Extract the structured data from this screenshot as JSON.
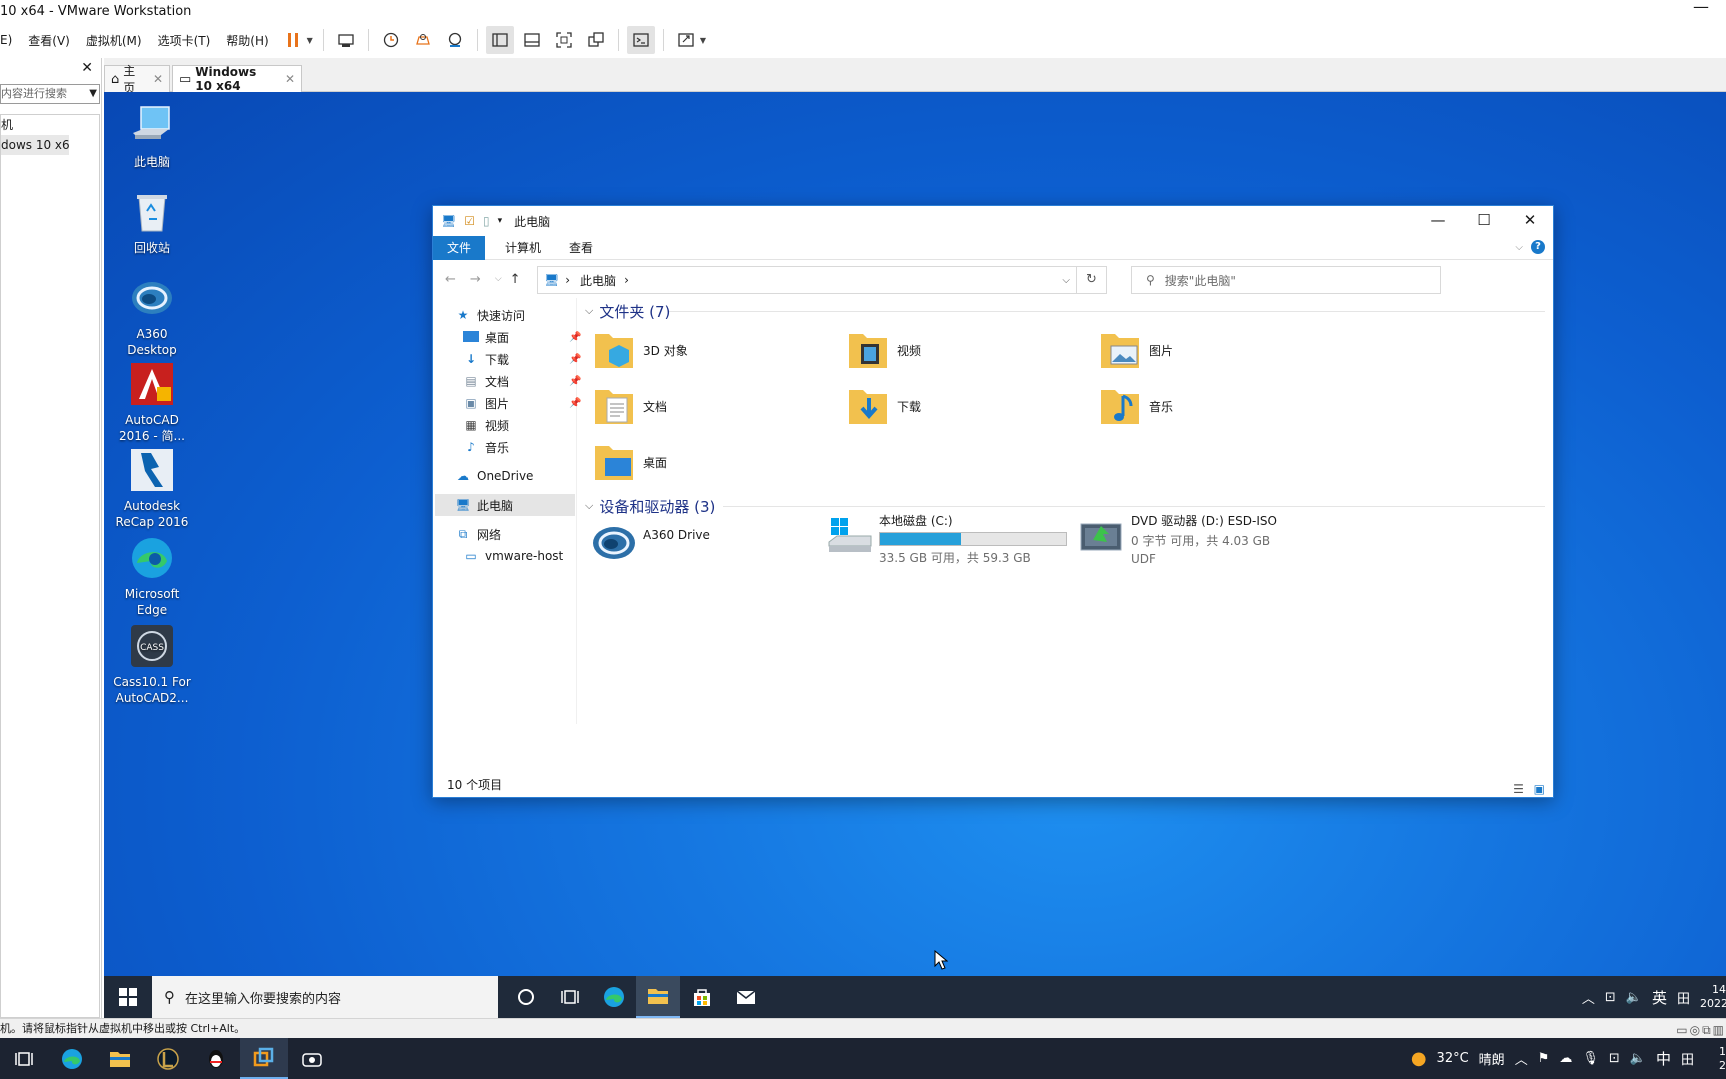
{
  "host_window": {
    "title": "10 x64 - VMware Workstation",
    "minimize": "—",
    "menus": [
      "E)",
      "查看(V)",
      "虚拟机(M)",
      "选项卡(T)",
      "帮助(H)"
    ]
  },
  "library": {
    "close": "✕",
    "search_text": "内容进行搜索",
    "tree": [
      "机",
      "dows 10 x64"
    ]
  },
  "vm_tabs": [
    {
      "label": "主页",
      "close": "✕"
    },
    {
      "label": "Windows 10 x64",
      "close": "✕"
    }
  ],
  "desktop_icons": [
    {
      "label": "此电脑",
      "icon": "computer-icon"
    },
    {
      "label": "回收站",
      "icon": "recycle-bin-icon"
    },
    {
      "label": "A360 Desktop",
      "icon": "a360-icon"
    },
    {
      "label": "AutoCAD 2016 - 简...",
      "icon": "autocad-icon"
    },
    {
      "label": "Autodesk ReCap 2016",
      "icon": "recap-icon"
    },
    {
      "label": "Microsoft Edge",
      "icon": "edge-icon"
    },
    {
      "label": "Cass10.1 For AutoCAD2...",
      "icon": "cass-icon"
    }
  ],
  "explorer": {
    "title": "此电脑",
    "window_controls": {
      "minimize": "—",
      "maximize": "☐",
      "close": "✕"
    },
    "ribbon_tabs": [
      "文件",
      "计算机",
      "查看"
    ],
    "help": "?",
    "address": {
      "path": "此电脑",
      "search_placeholder": "搜索\"此电脑\""
    },
    "nav": {
      "quick_access": "快速访问",
      "quick_items": [
        "桌面",
        "下载",
        "文档",
        "图片",
        "视频",
        "音乐"
      ],
      "onedrive": "OneDrive",
      "this_pc": "此电脑",
      "network": "网络",
      "network_items": [
        "vmware-host"
      ]
    },
    "folders_header": "文件夹 (7)",
    "folders": [
      "3D 对象",
      "视频",
      "图片",
      "文档",
      "下载",
      "音乐",
      "桌面"
    ],
    "devices_header": "设备和驱动器 (3)",
    "devices": [
      {
        "name": "A360 Drive"
      },
      {
        "name": "本地磁盘 (C:)",
        "detail": "33.5 GB 可用，共 59.3 GB",
        "used_fraction": 0.435
      },
      {
        "name": "DVD 驱动器 (D:) ESD-ISO",
        "detail": "0 字节 可用，共 4.03 GB",
        "detail2": "UDF"
      }
    ],
    "status": "10 个项目"
  },
  "guest_taskbar": {
    "search_placeholder": "在这里输入你要搜索的内容",
    "tray_lang": "英",
    "tray_ime": "田",
    "clock_time": "14",
    "clock_date": "2022"
  },
  "host_status": "机。请将鼠标指针从虚拟机中移出或按 Ctrl+Alt。",
  "host_taskbar": {
    "weather": "32°C",
    "weather_text": "晴朗",
    "ime": "中",
    "ime2": "田",
    "clock_time": "1",
    "clock_date": "2"
  },
  "colors": {
    "desktop": "#1576e0",
    "accent": "#1979ca",
    "disk_fill": "#26a0da"
  }
}
